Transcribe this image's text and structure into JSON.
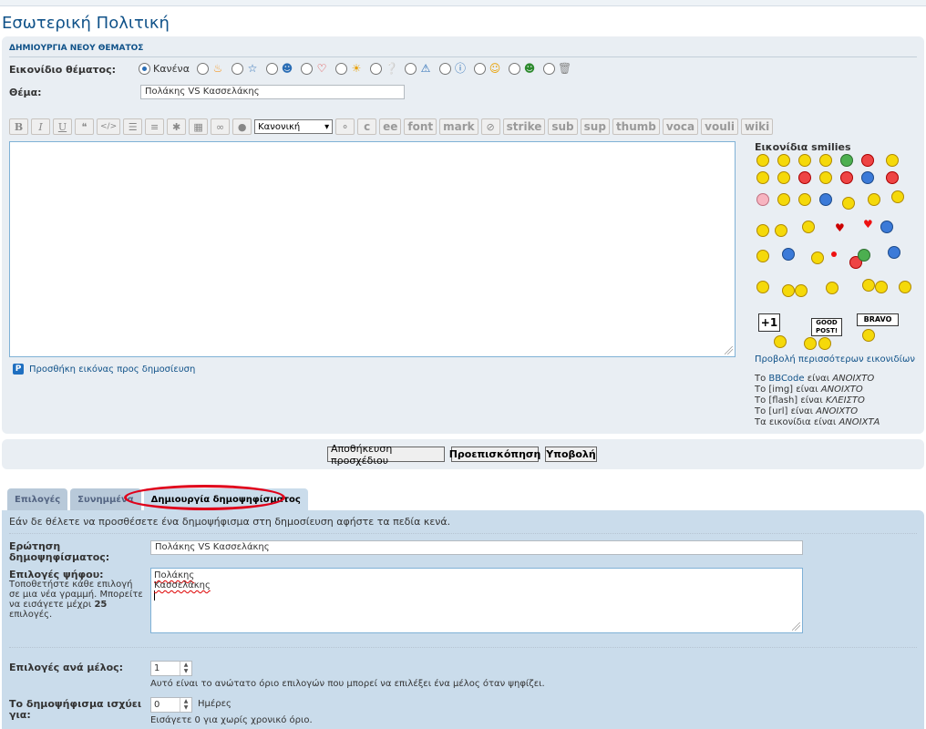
{
  "page": {
    "title": "Εσωτερική Πολιτική"
  },
  "form": {
    "header": "ΔΗΜΙΟΥΡΓΙΑ ΝΕΟΥ ΘΕΜΑΤΟΣ",
    "topic_icon_label": "Εικονίδιο θέματος:",
    "topic_icon_none": "Κανένα",
    "topic_icon_options": [
      "flame-icon",
      "star-icon",
      "smiley-icon",
      "heart-icon",
      "sun-icon",
      "question-icon",
      "warning-icon",
      "info-icon",
      "grin-icon",
      "alien-icon",
      "trash-icon"
    ],
    "subject_label": "Θέμα:",
    "subject_value": "Πολάκης VS Κασσελάκης"
  },
  "toolbar": {
    "icon_buttons": [
      "bold",
      "italic",
      "underline",
      "quote",
      "code",
      "list",
      "list-numbered",
      "list-item",
      "image",
      "link",
      "flash"
    ],
    "size_select": "Κανονική",
    "text_buttons": [
      "c",
      "ee",
      "font",
      "mark",
      "strike",
      "sub",
      "sup",
      "thumb",
      "voca",
      "vouli",
      "wiki"
    ]
  },
  "attach": {
    "label": "Προσθήκη εικόνας προς δημοσίευση"
  },
  "smilies": {
    "title": "Εικονίδια smilies",
    "signs": [
      "+1",
      "GOOD POST!",
      "BRAVO"
    ],
    "more_link": "Προβολή περισσότερων εικονιδίων"
  },
  "bbinfo": {
    "l1_a": "Το ",
    "l1_link": "BBCode",
    "l1_b": " είναι ",
    "l1_state": "ΑΝΟΙΧΤΟ",
    "l2_a": "Το [img] είναι ",
    "l2_state": "ΑΝΟΙΧΤΟ",
    "l3_a": "Το [flash] είναι ",
    "l3_state": "ΚΛΕΙΣΤΟ",
    "l4_a": "Το [url] είναι ",
    "l4_state": "ΑΝΟΙΧΤΟ",
    "l5_a": "Τα εικονίδια είναι ",
    "l5_state": "ΑΝΟΙΧΤΑ"
  },
  "buttons": {
    "save_draft": "Αποθήκευση προσχέδιου",
    "preview": "Προεπισκόπηση",
    "submit": "Υποβολή"
  },
  "tabs": [
    "Επιλογές",
    "Συνημμένα",
    "Δημιουργία δημοψηφίσματος"
  ],
  "poll": {
    "intro": "Εάν δε θέλετε να προσθέσετε ένα δημοψήφισμα στη δημοσίευση αφήστε τα πεδία κενά.",
    "question_label": "Ερώτηση δημοψηφίσματος:",
    "question_value": "Πολάκης VS Κασσελάκης",
    "options_label": "Επιλογές ψήφου:",
    "options_note_a": "Τοποθετήστε κάθε επιλογή σε μια νέα γραμμή. Μπορείτε να εισάγετε μέχρι ",
    "options_note_max": "25",
    "options_note_b": " επιλογές.",
    "options_lines": [
      "Πολάκης",
      "Κασσελάκης"
    ],
    "per_user_label": "Επιλογές ανά μέλος:",
    "per_user_value": "1",
    "per_user_help": "Αυτό είναι το ανώτατο όριο επιλογών που μπορεί να επιλέξει ένα μέλος όταν ψηφίζει.",
    "duration_label": "Το δημοψήφισμα ισχύει για:",
    "duration_value": "0",
    "duration_unit": "Ημέρες",
    "duration_help": "Εισάγετε 0 για χωρίς χρονικό όριο."
  },
  "colors": {
    "link": "#105289",
    "panel": "#e9eef3",
    "poll_panel": "#cadceb",
    "highlight_ring": "#e0001a"
  }
}
